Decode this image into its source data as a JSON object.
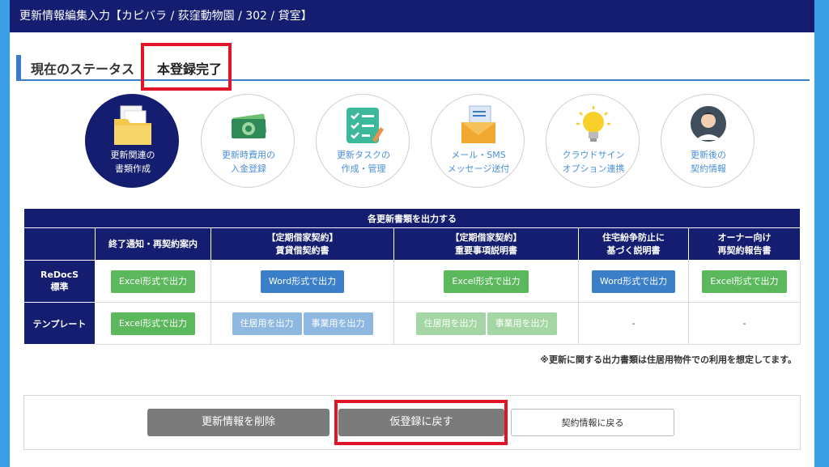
{
  "titlebar": {
    "title": "更新情報編集入力【カピバラ / 荻窪動物園 / 302 / 貸室】"
  },
  "status": {
    "label": "現在のステータス",
    "value": "本登録完了"
  },
  "steps": [
    {
      "line1": "更新関連の",
      "line2": "書類作成",
      "icon": "folder-icon",
      "active": true
    },
    {
      "line1": "更新時費用の",
      "line2": "入金登録",
      "icon": "money-icon",
      "active": false
    },
    {
      "line1": "更新タスクの",
      "line2": "作成・管理",
      "icon": "checklist-icon",
      "active": false
    },
    {
      "line1": "メール・SMS",
      "line2": "メッセージ送付",
      "icon": "mail-icon",
      "active": false
    },
    {
      "line1": "クラウドサイン",
      "line2": "オプション連携",
      "icon": "lightbulb-icon",
      "active": false
    },
    {
      "line1": "更新後の",
      "line2": "契約情報",
      "icon": "person-icon",
      "active": false
    }
  ],
  "docs_table": {
    "caption": "各更新書類を出力する",
    "columns": [
      {
        "line1": "終了通知・再契約案内",
        "line2": ""
      },
      {
        "line1": "【定期借家契約】",
        "line2": "賃貸借契約書"
      },
      {
        "line1": "【定期借家契約】",
        "line2": "重要事項説明書"
      },
      {
        "line1": "住宅紛争防止に",
        "line2": "基づく説明書"
      },
      {
        "line1": "オーナー向け",
        "line2": "再契約報告書"
      }
    ],
    "rows": [
      {
        "label_line1": "ReDocS",
        "label_line2": "標準",
        "cells": [
          "Excel形式で出力",
          "Word形式で出力",
          "Excel形式で出力",
          "Word形式で出力",
          "Excel形式で出力"
        ]
      },
      {
        "label_line1": "テンプレート",
        "cells": [
          "Excel形式で出力",
          "住居用を出力",
          "事業用を出力",
          "住居用を出力",
          "事業用を出力",
          "-",
          "-"
        ]
      }
    ],
    "note": "※更新に関する出力書類は住居用物件での利用を想定してます。"
  },
  "actions": {
    "delete": "更新情報を削除",
    "revert": "仮登録に戻す",
    "back": "契約情報に戻る"
  },
  "colors": {
    "navy": "#141d6f",
    "accent_blue": "#3b7cc7",
    "green": "#5cb85c",
    "highlight_red": "#e0152a"
  }
}
